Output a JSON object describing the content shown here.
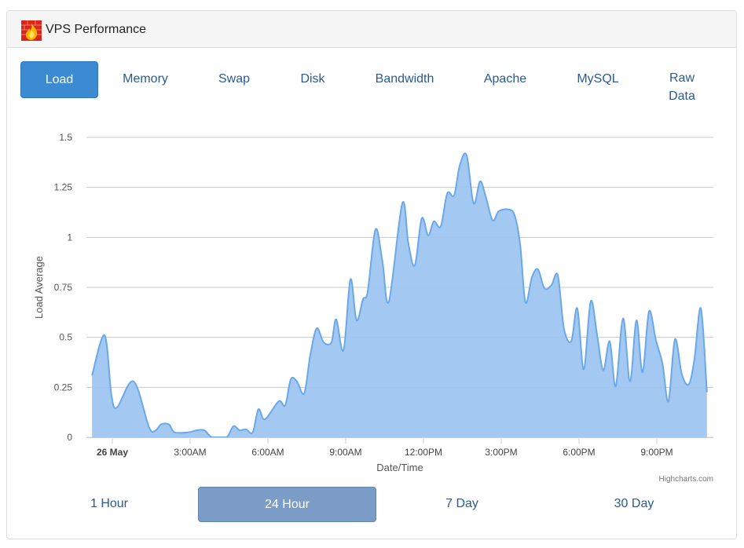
{
  "header": {
    "title": "VPS Performance",
    "logo_icon": "firewall-flame-icon"
  },
  "tabs": [
    {
      "label": "Load",
      "active": true
    },
    {
      "label": "Memory"
    },
    {
      "label": "Swap"
    },
    {
      "label": "Disk"
    },
    {
      "label": "Bandwidth"
    },
    {
      "label": "Apache"
    },
    {
      "label": "MySQL"
    },
    {
      "label": "Raw Data"
    }
  ],
  "ranges": [
    {
      "label": "1 Hour"
    },
    {
      "label": "24 Hour",
      "active": true
    },
    {
      "label": "7 Day"
    },
    {
      "label": "30 Day"
    }
  ],
  "credit": "Highcharts.com",
  "colors": {
    "accent": "#3c8ad1",
    "area_fill": "#9ec6f1",
    "area_line": "#6aa8e8",
    "range_active": "#7b9cc6"
  },
  "chart_data": {
    "type": "area",
    "xlabel": "Date/Time",
    "ylabel": "Load Average",
    "ylim": [
      0,
      1.5
    ],
    "yticks": [
      "0",
      "0.25",
      "0.5",
      "0.75",
      "1",
      "1.25",
      "1.5"
    ],
    "xticks": [
      "26 May",
      "3:00AM",
      "6:00AM",
      "9:00AM",
      "12:00PM",
      "3:00PM",
      "6:00PM",
      "9:00PM"
    ],
    "grid": true,
    "legend": "none",
    "series": [
      {
        "points": [
          [
            "25 May 23:13",
            0.31
          ],
          [
            "25 May 23:42",
            0.51
          ],
          [
            "25 May 23:58",
            0.21
          ],
          [
            "00:11",
            0.15
          ],
          [
            "00:49",
            0.28
          ],
          [
            "01:25",
            0.05
          ],
          [
            "01:40",
            0.035
          ],
          [
            "01:53",
            0.065
          ],
          [
            "02:11",
            0.065
          ],
          [
            "02:24",
            0.025
          ],
          [
            "02:56",
            0.025
          ],
          [
            "03:15",
            0.035
          ],
          [
            "03:33",
            0.035
          ],
          [
            "03:51",
            0.0
          ],
          [
            "04:24",
            0.0
          ],
          [
            "04:40",
            0.055
          ],
          [
            "04:55",
            0.035
          ],
          [
            "05:09",
            0.04
          ],
          [
            "05:25",
            0.025
          ],
          [
            "05:38",
            0.14
          ],
          [
            "05:53",
            0.09
          ],
          [
            "06:25",
            0.18
          ],
          [
            "06:40",
            0.16
          ],
          [
            "06:53",
            0.29
          ],
          [
            "07:07",
            0.28
          ],
          [
            "07:24",
            0.22
          ],
          [
            "07:38",
            0.41
          ],
          [
            "07:53",
            0.545
          ],
          [
            "08:09",
            0.475
          ],
          [
            "08:27",
            0.475
          ],
          [
            "08:38",
            0.59
          ],
          [
            "08:55",
            0.435
          ],
          [
            "09:11",
            0.79
          ],
          [
            "09:25",
            0.585
          ],
          [
            "09:40",
            0.69
          ],
          [
            "09:51",
            0.73
          ],
          [
            "10:09",
            1.04
          ],
          [
            "10:25",
            0.88
          ],
          [
            "10:40",
            0.68
          ],
          [
            "11:11",
            1.17
          ],
          [
            "11:25",
            0.97
          ],
          [
            "11:40",
            0.86
          ],
          [
            "11:56",
            1.095
          ],
          [
            "12:11",
            1.01
          ],
          [
            "12:24",
            1.08
          ],
          [
            "12:40",
            1.055
          ],
          [
            "12:55",
            1.22
          ],
          [
            "13:11",
            1.21
          ],
          [
            "13:24",
            1.36
          ],
          [
            "13:40",
            1.41
          ],
          [
            "13:56",
            1.17
          ],
          [
            "14:11",
            1.28
          ],
          [
            "14:24",
            1.205
          ],
          [
            "14:40",
            1.085
          ],
          [
            "14:54",
            1.13
          ],
          [
            "15:16",
            1.14
          ],
          [
            "15:31",
            1.11
          ],
          [
            "15:44",
            0.96
          ],
          [
            "15:56",
            0.675
          ],
          [
            "16:11",
            0.8
          ],
          [
            "16:25",
            0.84
          ],
          [
            "16:40",
            0.745
          ],
          [
            "16:56",
            0.76
          ],
          [
            "17:11",
            0.81
          ],
          [
            "17:25",
            0.545
          ],
          [
            "17:42",
            0.48
          ],
          [
            "17:56",
            0.645
          ],
          [
            "18:11",
            0.34
          ],
          [
            "18:27",
            0.68
          ],
          [
            "18:42",
            0.51
          ],
          [
            "18:56",
            0.335
          ],
          [
            "19:11",
            0.48
          ],
          [
            "19:25",
            0.255
          ],
          [
            "19:42",
            0.595
          ],
          [
            "19:58",
            0.28
          ],
          [
            "20:13",
            0.585
          ],
          [
            "20:27",
            0.325
          ],
          [
            "20:42",
            0.63
          ],
          [
            "20:58",
            0.485
          ],
          [
            "21:13",
            0.37
          ],
          [
            "21:27",
            0.18
          ],
          [
            "21:42",
            0.49
          ],
          [
            "21:58",
            0.315
          ],
          [
            "22:14",
            0.265
          ],
          [
            "22:27",
            0.39
          ],
          [
            "22:42",
            0.645
          ],
          [
            "22:56",
            0.225
          ]
        ]
      }
    ]
  }
}
